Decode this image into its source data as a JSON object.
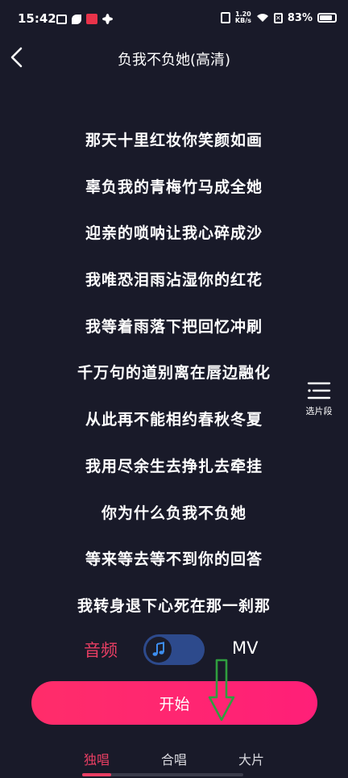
{
  "status_bar": {
    "time": "15:42",
    "speed_top": "1.20",
    "speed_bottom": "KB/s",
    "battery": "83%",
    "battery_level": 0.83
  },
  "header": {
    "title": "负我不负她(高清)"
  },
  "lyrics": [
    "那天十里红妆你笑颜如画",
    "辜负我的青梅竹马成全她",
    "迎亲的唢呐让我心碎成沙",
    "我唯恐泪雨沾湿你的红花",
    "我等着雨落下把回忆冲刷",
    "千万句的道别离在唇边融化",
    "从此再不能相约春秋冬夏",
    "我用尽余生去挣扎去牵挂",
    "你为什么负我不负她",
    "等来等去等不到你的回答",
    "我转身退下心死在那一刹那"
  ],
  "segment_picker": {
    "label": "选片段",
    "icon": "segment-list-icon"
  },
  "mode": {
    "audio_label": "音频",
    "mv_label": "MV",
    "toggle_icon": "music-note-icon"
  },
  "start_button": {
    "label": "开始"
  },
  "tabs": [
    {
      "label": "独唱",
      "active": true
    },
    {
      "label": "合唱",
      "active": false
    },
    {
      "label": "大片",
      "active": false
    }
  ],
  "colors": {
    "background": "#191a29",
    "accent": "#e83e63",
    "button": "#ff2d6a",
    "toggle": "#2d4a8c",
    "annotation_arrow": "#2f9e3f"
  }
}
